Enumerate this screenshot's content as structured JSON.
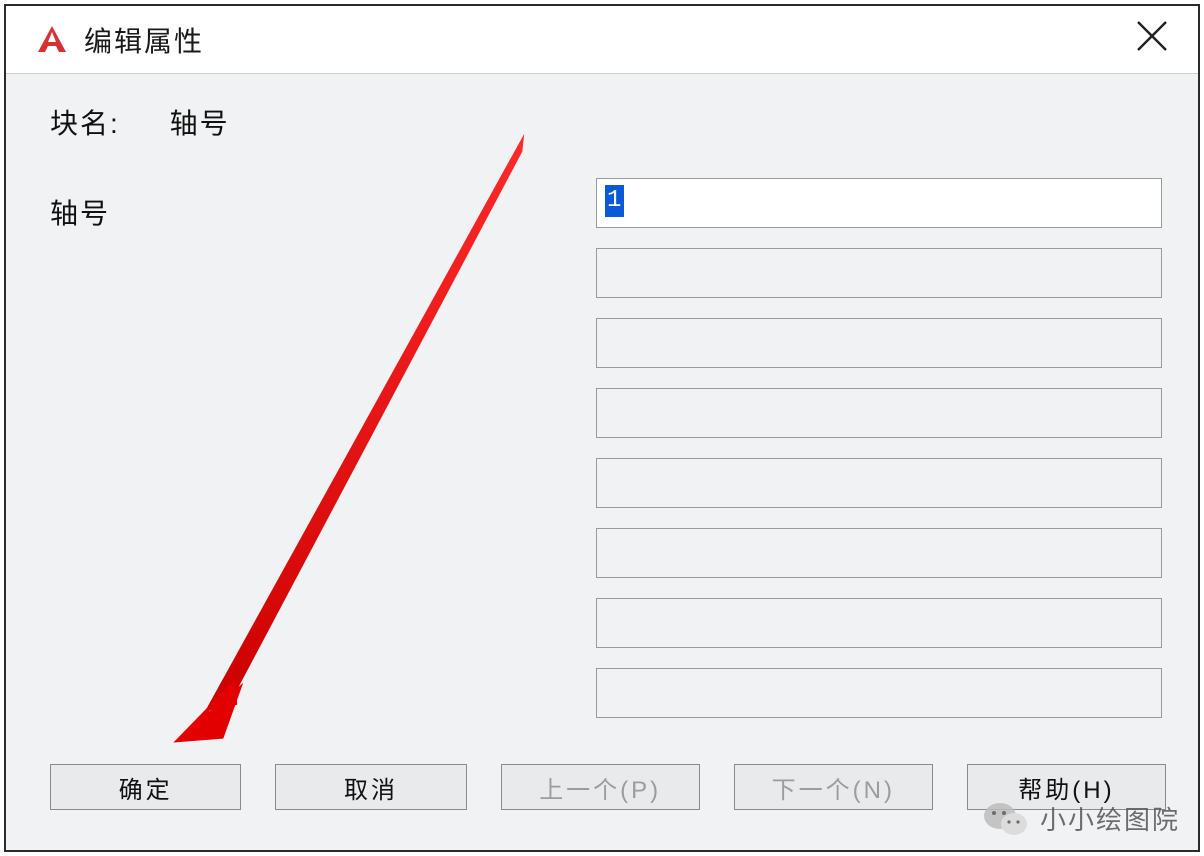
{
  "titlebar": {
    "title": "编辑属性"
  },
  "block": {
    "label": "块名:",
    "name": "轴号"
  },
  "attribute": {
    "label": "轴号",
    "value": "1"
  },
  "extra_fields": [
    "",
    "",
    "",
    "",
    "",
    "",
    ""
  ],
  "buttons": {
    "ok": "确定",
    "cancel": "取消",
    "prev": "上一个(P)",
    "next": "下一个(N)",
    "help": "帮助(H)"
  },
  "watermark": {
    "text": "小小绘图院"
  }
}
